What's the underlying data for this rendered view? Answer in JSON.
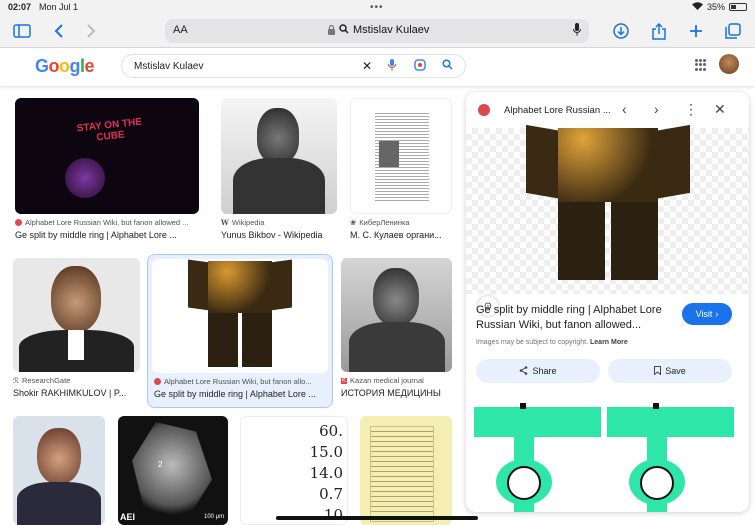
{
  "status": {
    "time": "02:07",
    "date": "Mon Jul 1",
    "battery": "35%"
  },
  "toolbar": {
    "aa": "AA",
    "url": "Mstislav Kulaev"
  },
  "google": {
    "logo": "Google",
    "query": "Mstislav Kulaev"
  },
  "results": [
    {
      "source": "Alphabet Lore Russian Wiki, but fanon allowed ...",
      "title": "Ge split by middle ring | Alphabet Lore ...",
      "overlay": "STAY ON THE CUBE"
    },
    {
      "source": "Wikipedia",
      "title": "Yunus Bikbov - Wikipedia"
    },
    {
      "source": "КиберЛенинка",
      "title": "М. С. Кулаев органи..."
    },
    {
      "source": "ResearchGate",
      "title": "Shokir RAKHIMKULOV | P..."
    },
    {
      "source": "Alphabet Lore Russian Wiki, but fanon allo...",
      "title": "Ge split by middle ring | Alphabet Lore ..."
    },
    {
      "source": "Kazan medical journal",
      "title": "ИСТОРИЯ МЕДИЦИНЫ"
    }
  ],
  "bottom_row": {
    "microscope_labels": [
      "AEI",
      "2",
      "100 μm"
    ],
    "numbers": [
      "60.",
      "15.0",
      "14.0",
      "0.7",
      "10"
    ]
  },
  "panel": {
    "source": "Alphabet Lore Russian ...",
    "title": "Ge split by middle ring | Alphabet Lore Russian Wiki, but fanon allowed...",
    "visit": "Visit",
    "copyright_text": "Images may be subject to copyright.",
    "learn_more": "Learn More",
    "share": "Share",
    "save": "Save"
  },
  "colors": {
    "accent": "#1a73e8",
    "selected_bg": "#e8f0fe",
    "related_green": "#2ee6a8"
  }
}
